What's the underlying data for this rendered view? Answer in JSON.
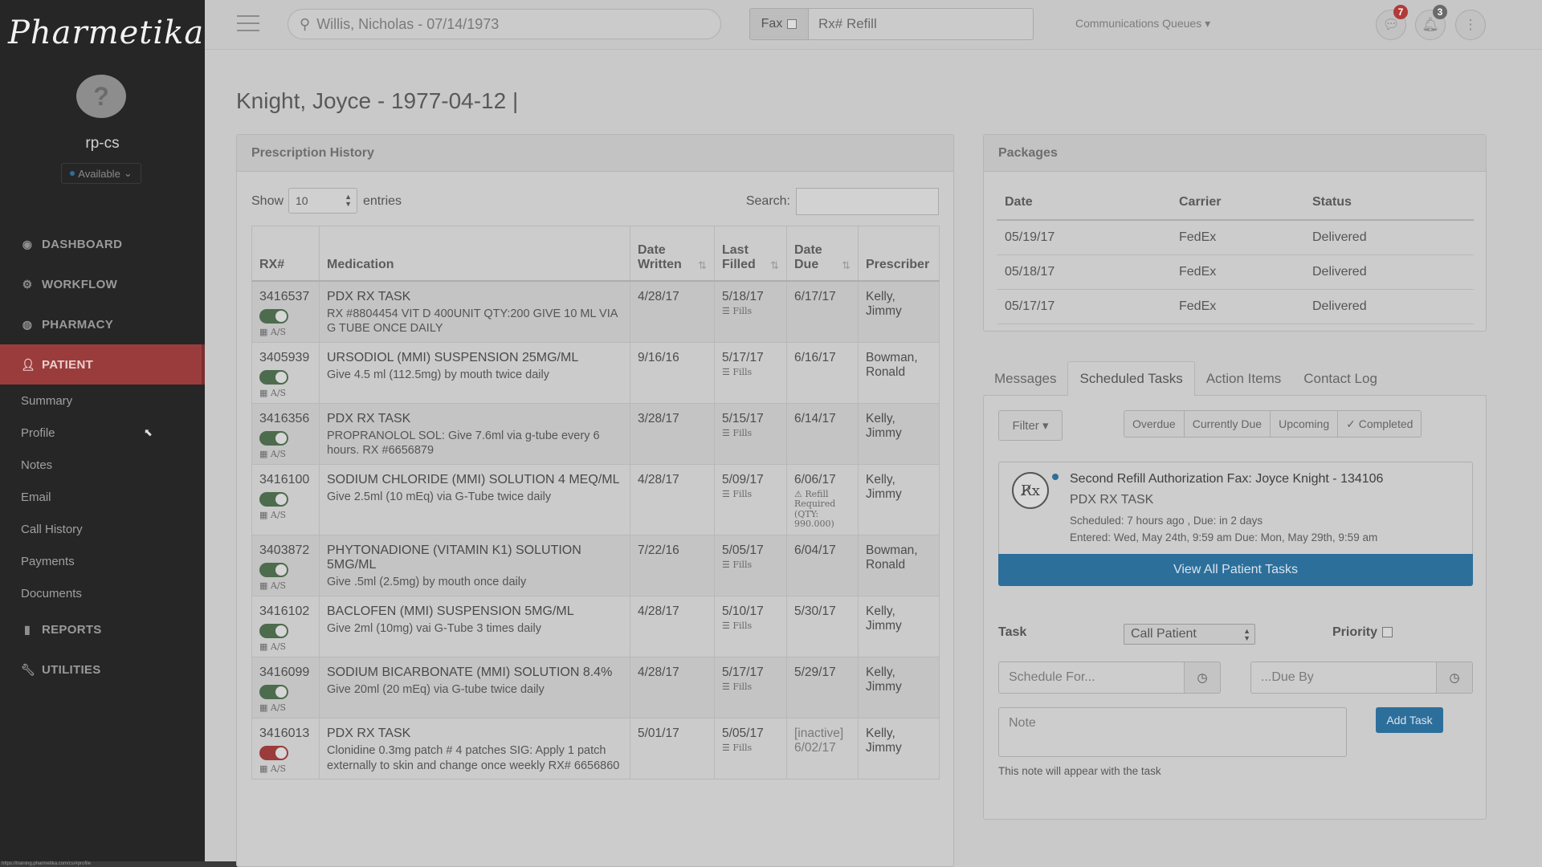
{
  "app": {
    "logo_text": "Pharmetika",
    "username": "rp-cs",
    "availability": "Available",
    "status_url": "https://training.pharmetika.com/cs/#profile"
  },
  "nav": {
    "items": [
      {
        "label": "DASHBOARD",
        "icon": "dashboard-icon"
      },
      {
        "label": "WORKFLOW",
        "icon": "cogs-icon"
      },
      {
        "label": "PHARMACY",
        "icon": "globe-icon"
      },
      {
        "label": "PATIENT",
        "icon": "user-icon"
      },
      {
        "label": "REPORTS",
        "icon": "bar-chart-icon"
      },
      {
        "label": "UTILITIES",
        "icon": "wrench-icon"
      }
    ],
    "patient_sub": [
      "Summary",
      "Profile",
      "Notes",
      "Email",
      "Call History",
      "Payments",
      "Documents"
    ]
  },
  "topbar": {
    "search_value": "Willis, Nicholas - 07/14/1973",
    "fax_label": "Fax",
    "rx_placeholder": "Rx# Refill",
    "comm_queues": "Communications Queues",
    "messages_badge": "7",
    "notifications_badge": "3"
  },
  "page": {
    "title": "Knight, Joyce - 1977-04-12 |"
  },
  "rx_history": {
    "title": "Prescription History",
    "show_label": "Show",
    "entries_value": "10",
    "entries_label": "entries",
    "search_label": "Search:",
    "columns": [
      "RX#",
      "Medication",
      "Date Written",
      "Last Filled",
      "Date Due",
      "Prescriber"
    ],
    "fills_label": "Fills",
    "as_label": "A/S",
    "rows": [
      {
        "rx": "3416537",
        "name": "PDX RX TASK",
        "sig": "RX #8804454 VIT D 400UNIT QTY:200 GIVE 10 ML VIA G TUBE ONCE DAILY",
        "written": "4/28/17",
        "filled": "5/18/17",
        "due": "6/17/17",
        "prescriber": "Kelly, Jimmy",
        "active": true
      },
      {
        "rx": "3405939",
        "name": "URSODIOL (MMI) SUSPENSION 25MG/ML",
        "sig": "Give 4.5 ml (112.5mg) by mouth twice daily",
        "written": "9/16/16",
        "filled": "5/17/17",
        "due": "6/16/17",
        "prescriber": "Bowman, Ronald",
        "active": true
      },
      {
        "rx": "3416356",
        "name": "PDX RX TASK",
        "sig": "PROPRANOLOL SOL: Give 7.6ml via g-tube every 6 hours. RX #6656879",
        "written": "3/28/17",
        "filled": "5/15/17",
        "due": "6/14/17",
        "prescriber": "Kelly, Jimmy",
        "active": true
      },
      {
        "rx": "3416100",
        "name": "SODIUM CHLORIDE (MMI) SOLUTION 4 MEQ/ML",
        "sig": "Give 2.5ml (10 mEq) via G-Tube twice daily",
        "written": "4/28/17",
        "filled": "5/09/17",
        "due": "6/06/17",
        "prescriber": "Kelly, Jimmy",
        "active": true,
        "warning": "Refill Required (QTY: 990.000)"
      },
      {
        "rx": "3403872",
        "name": "PHYTONADIONE (VITAMIN K1) SOLUTION 5MG/ML",
        "sig": "Give .5ml (2.5mg) by mouth once daily",
        "written": "7/22/16",
        "filled": "5/05/17",
        "due": "6/04/17",
        "prescriber": "Bowman, Ronald",
        "active": true
      },
      {
        "rx": "3416102",
        "name": "BACLOFEN (MMI) SUSPENSION 5MG/ML",
        "sig": "Give 2ml (10mg) vai G-Tube 3 times daily",
        "written": "4/28/17",
        "filled": "5/10/17",
        "due": "5/30/17",
        "prescriber": "Kelly, Jimmy",
        "active": true
      },
      {
        "rx": "3416099",
        "name": "SODIUM BICARBONATE (MMI) SOLUTION 8.4%",
        "sig": "Give 20ml (20 mEq) via G-tube twice daily",
        "written": "4/28/17",
        "filled": "5/17/17",
        "due": "5/29/17",
        "prescriber": "Kelly, Jimmy",
        "active": true
      },
      {
        "rx": "3416013",
        "name": "PDX RX TASK",
        "sig": "Clonidine 0.3mg patch # 4 patches SIG: Apply 1 patch externally to skin and change once weekly RX# 6656860",
        "written": "5/01/17",
        "filled": "5/05/17",
        "due": "[inactive] 6/02/17",
        "prescriber": "Kelly, Jimmy",
        "active": false
      }
    ]
  },
  "packages": {
    "title": "Packages",
    "columns": [
      "Date",
      "Carrier",
      "Status"
    ],
    "rows": [
      {
        "date": "05/19/17",
        "carrier": "FedEx",
        "status": "Delivered"
      },
      {
        "date": "05/18/17",
        "carrier": "FedEx",
        "status": "Delivered"
      },
      {
        "date": "05/17/17",
        "carrier": "FedEx",
        "status": "Delivered"
      }
    ]
  },
  "tabs": [
    "Messages",
    "Scheduled Tasks",
    "Action Items",
    "Contact Log"
  ],
  "tasks": {
    "filter_label": "Filter",
    "segments": [
      "Overdue",
      "Currently Due",
      "Upcoming",
      "✓ Completed"
    ],
    "card": {
      "title": "Second Refill Authorization Fax: Joyce Knight - 134106",
      "subtitle": "PDX RX TASK",
      "scheduled": "Scheduled: 7 hours ago , Due: in 2 days",
      "entered": "Entered: Wed, May 24th, 9:59 am Due: Mon, May 29th, 9:59 am"
    },
    "view_all": "View All Patient Tasks",
    "task_label": "Task",
    "task_value": "Call Patient",
    "priority_label": "Priority",
    "schedule_placeholder": "Schedule For...",
    "due_placeholder": "...Due By",
    "note_placeholder": "Note",
    "add_task": "Add Task",
    "note_hint": "This note will appear with the task"
  }
}
